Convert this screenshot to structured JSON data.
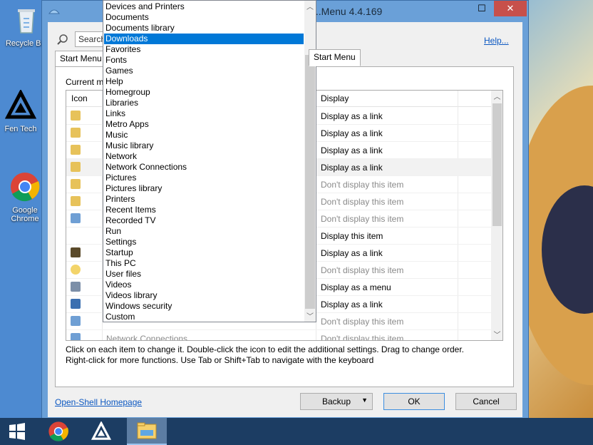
{
  "desktop": {
    "icons": [
      {
        "label": "Recycle Bin"
      },
      {
        "label": "Fen Tech"
      },
      {
        "label": "Google Chrome"
      }
    ]
  },
  "window": {
    "title": "...Menu 4.4.169",
    "controls": {
      "minimize": "─",
      "maximize": "☐",
      "close": "✕"
    }
  },
  "toolbar": {
    "search_placeholder": "Search",
    "help_link": "Help..."
  },
  "tabs": [
    {
      "label": "Start Menu"
    },
    {
      "label": "Start Menu"
    }
  ],
  "panel": {
    "current_label": "Current m",
    "columns": {
      "icon": "Icon",
      "display": "Display"
    },
    "rows": [
      {
        "display": "Display as a link",
        "dim": false,
        "icon": "folder-icon"
      },
      {
        "display": "Display as a link",
        "dim": false,
        "icon": "folder-icon"
      },
      {
        "display": "Display as a link",
        "dim": false,
        "icon": "folder-icon"
      },
      {
        "display": "Display as a link",
        "dim": false,
        "icon": "folder-icon",
        "highlight": true
      },
      {
        "display": "Don't display this item",
        "dim": true,
        "icon": "folder-icon"
      },
      {
        "display": "Don't display this item",
        "dim": true,
        "icon": "folder-icon"
      },
      {
        "display": "Don't display this item",
        "dim": true,
        "icon": "network-icon"
      },
      {
        "display": "Display this item",
        "dim": false,
        "icon": ""
      },
      {
        "display": "Display as a link",
        "dim": false,
        "icon": "startup-icon"
      },
      {
        "display": "Don't display this item",
        "dim": true,
        "icon": "star-icon"
      },
      {
        "display": "Display as a menu",
        "dim": false,
        "icon": "settings-icon"
      },
      {
        "display": "Display as a link",
        "dim": false,
        "icon": "security-icon"
      },
      {
        "display": "Don't display this item",
        "dim": true,
        "icon": "network-icon"
      },
      {
        "display": "Don't display this item",
        "dim": true,
        "icon": "network-icon",
        "name": "Network Connections"
      }
    ],
    "instructions_line1": "Click on each item to change it. Double-click the icon to edit the additional settings. Drag to change order.",
    "instructions_line2": "Right-click for more functions. Use Tab or Shift+Tab to navigate with the keyboard"
  },
  "footer": {
    "homepage_link": "Open-Shell Homepage",
    "backup": "Backup",
    "ok": "OK",
    "cancel": "Cancel"
  },
  "dropdown": {
    "selected": "Downloads",
    "items": [
      "Devices and Printers",
      "Documents",
      "Documents library",
      "Downloads",
      "Favorites",
      "Fonts",
      "Games",
      "Help",
      "Homegroup",
      "Libraries",
      "Links",
      "Metro Apps",
      "Music",
      "Music library",
      "Network",
      "Network Connections",
      "Pictures",
      "Pictures library",
      "Printers",
      "Recent Items",
      "Recorded TV",
      "Run",
      "Settings",
      "Startup",
      "This PC",
      "User files",
      "Videos",
      "Videos library",
      "Windows security",
      "Custom"
    ]
  },
  "taskbar": {
    "items": [
      {
        "icon": "windows-start-icon"
      },
      {
        "icon": "chrome-icon"
      },
      {
        "icon": "fen-tech-icon"
      },
      {
        "icon": "file-explorer-icon",
        "active": true
      }
    ]
  },
  "colors": {
    "accent": "#0078d7",
    "link": "#0b57c1",
    "close": "#c7504b"
  }
}
